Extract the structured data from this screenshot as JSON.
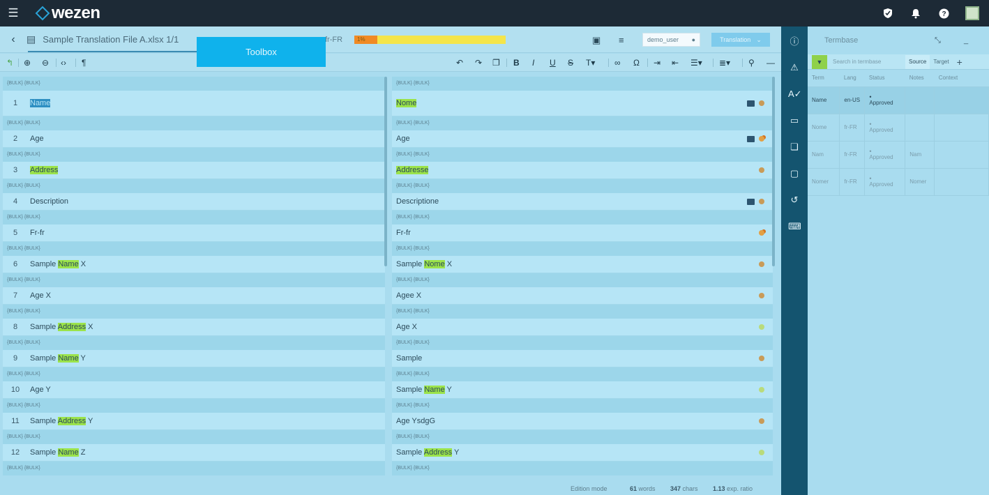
{
  "topbar": {
    "menu_icon": "hamburger-icon",
    "logo_text": "wezen"
  },
  "filebar": {
    "file_name": "Sample Translation File A.xlsx 1/1",
    "target_lang": "fr-FR",
    "progress_label": "1%",
    "progress_percent": 15,
    "user": "demo_user",
    "mode": "Translation"
  },
  "toolbox": {
    "label": "Toolbox"
  },
  "segment_header": "{BULK} {BULK}",
  "segments": [
    {
      "num": "1",
      "src_pre": "",
      "src_hl": "Name",
      "src_post": "",
      "src_sel": true,
      "tgt_pre": "",
      "tgt_hl": "Nome",
      "tgt_post": "",
      "dot": "brown",
      "comment": true,
      "tall": true
    },
    {
      "num": "2",
      "src_pre": "Age",
      "src_hl": "",
      "src_post": "",
      "src_sel": false,
      "tgt_pre": "Age",
      "tgt_hl": "",
      "tgt_post": "",
      "dot": "orange",
      "comment": true,
      "tall": false
    },
    {
      "num": "3",
      "src_pre": "",
      "src_hl": "Address",
      "src_post": "",
      "src_sel": false,
      "tgt_pre": "",
      "tgt_hl": "Addresse",
      "tgt_post": "",
      "dot": "brown",
      "comment": false,
      "tall": false
    },
    {
      "num": "4",
      "src_pre": "Description",
      "src_hl": "",
      "src_post": "",
      "src_sel": false,
      "tgt_pre": "Descriptione",
      "tgt_hl": "",
      "tgt_post": "",
      "dot": "brown",
      "comment": true,
      "tall": false
    },
    {
      "num": "5",
      "src_pre": "Fr-fr",
      "src_hl": "",
      "src_post": "",
      "src_sel": false,
      "tgt_pre": "Fr-fr",
      "tgt_hl": "",
      "tgt_post": "",
      "dot": "orange",
      "comment": false,
      "tall": false
    },
    {
      "num": "6",
      "src_pre": "Sample ",
      "src_hl": "Name",
      "src_post": " X",
      "src_sel": false,
      "tgt_pre": "Sample ",
      "tgt_hl": "Nome",
      "tgt_post": " X",
      "dot": "brown",
      "comment": false,
      "tall": false
    },
    {
      "num": "7",
      "src_pre": "Age X",
      "src_hl": "",
      "src_post": "",
      "src_sel": false,
      "tgt_pre": "Agee X",
      "tgt_hl": "",
      "tgt_post": "",
      "dot": "brown",
      "comment": false,
      "tall": false
    },
    {
      "num": "8",
      "src_pre": "Sample ",
      "src_hl": "Address",
      "src_post": " X",
      "src_sel": false,
      "tgt_pre": "Age X",
      "tgt_hl": "",
      "tgt_post": "",
      "dot": "green",
      "comment": false,
      "tall": false
    },
    {
      "num": "9",
      "src_pre": "Sample ",
      "src_hl": "Name",
      "src_post": " Y",
      "src_sel": false,
      "tgt_pre": "Sample",
      "tgt_hl": "",
      "tgt_post": "",
      "dot": "brown",
      "comment": false,
      "tall": false
    },
    {
      "num": "10",
      "src_pre": "Age Y",
      "src_hl": "",
      "src_post": "",
      "src_sel": false,
      "tgt_pre": "Sample ",
      "tgt_hl": "Name",
      "tgt_post": " Y",
      "dot": "green",
      "comment": false,
      "tall": false
    },
    {
      "num": "11",
      "src_pre": "Sample ",
      "src_hl": "Address",
      "src_post": " Y",
      "src_sel": false,
      "tgt_pre": "Age YsdgG",
      "tgt_hl": "",
      "tgt_post": "",
      "dot": "brown",
      "comment": false,
      "tall": false
    },
    {
      "num": "12",
      "src_pre": "Sample ",
      "src_hl": "Name",
      "src_post": " Z",
      "src_sel": false,
      "tgt_pre": "Sample ",
      "tgt_hl": "Address",
      "tgt_post": " Y",
      "dot": "green",
      "comment": false,
      "tall": false
    }
  ],
  "statusbar": {
    "mode": "Edition mode",
    "words": "61",
    "words_label": "words",
    "chars": "347",
    "chars_label": "chars",
    "ratio": "1.13",
    "ratio_label": "exp. ratio"
  },
  "termbase": {
    "title": "Termbase",
    "search_placeholder": "Search in termbase",
    "opt_source": "Source",
    "opt_target": "Target",
    "columns": [
      "Term",
      "Lang",
      "Status",
      "Notes",
      "Context"
    ],
    "rows": [
      {
        "term": "Name",
        "lang": "en-US",
        "status": "Approved",
        "notes": "",
        "selected": true
      },
      {
        "term": "Nome",
        "lang": "fr-FR",
        "status": "Approved",
        "notes": "",
        "selected": false
      },
      {
        "term": "Nam",
        "lang": "fr-FR",
        "status": "Approved",
        "notes": "Nam",
        "selected": false
      },
      {
        "term": "Nomer",
        "lang": "fr-FR",
        "status": "Approved",
        "notes": "Nomer",
        "selected": false
      }
    ]
  },
  "colors": {
    "topbar": "#1d2a36",
    "rail": "#14546f",
    "accent": "#0fb2ec",
    "highlight": "#9be34a"
  }
}
